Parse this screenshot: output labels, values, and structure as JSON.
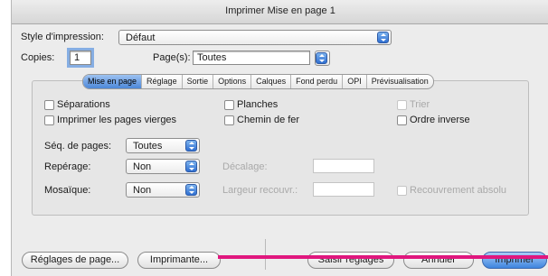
{
  "window": {
    "title": "Imprimer Mise en page 1"
  },
  "style": {
    "label": "Style d'impression:",
    "value": "Défaut"
  },
  "copies": {
    "label": "Copies:",
    "value": "1"
  },
  "pages": {
    "label": "Page(s):",
    "value": "Toutes"
  },
  "tabs": [
    "Mise en page",
    "Réglage",
    "Sortie",
    "Options",
    "Calques",
    "Fond perdu",
    "OPI",
    "Prévisualisation"
  ],
  "options": {
    "separations": "Séparations",
    "planches": "Planches",
    "trier": "Trier",
    "blank_pages": "Imprimer les pages vierges",
    "chemin": "Chemin de fer",
    "reverse": "Ordre inverse"
  },
  "sequence": {
    "label": "Séq. de pages:",
    "value": "Toutes"
  },
  "registration": {
    "label": "Repérage:",
    "value": "Non"
  },
  "offset": {
    "label": "Décalage:"
  },
  "tiling": {
    "label": "Mosaïque:",
    "value": "Non"
  },
  "overlap": {
    "label": "Largeur recouvr.:"
  },
  "absolute_overlap": {
    "label": "Recouvrement absolu"
  },
  "buttons": {
    "page_setup": "Réglages de page...",
    "printer": "Imprimante...",
    "capture": "Saisir réglages",
    "cancel": "Annuler",
    "print": "Imprimer"
  },
  "colors": {
    "accent_line": "#e0177e",
    "selection": "#4c87d8"
  }
}
